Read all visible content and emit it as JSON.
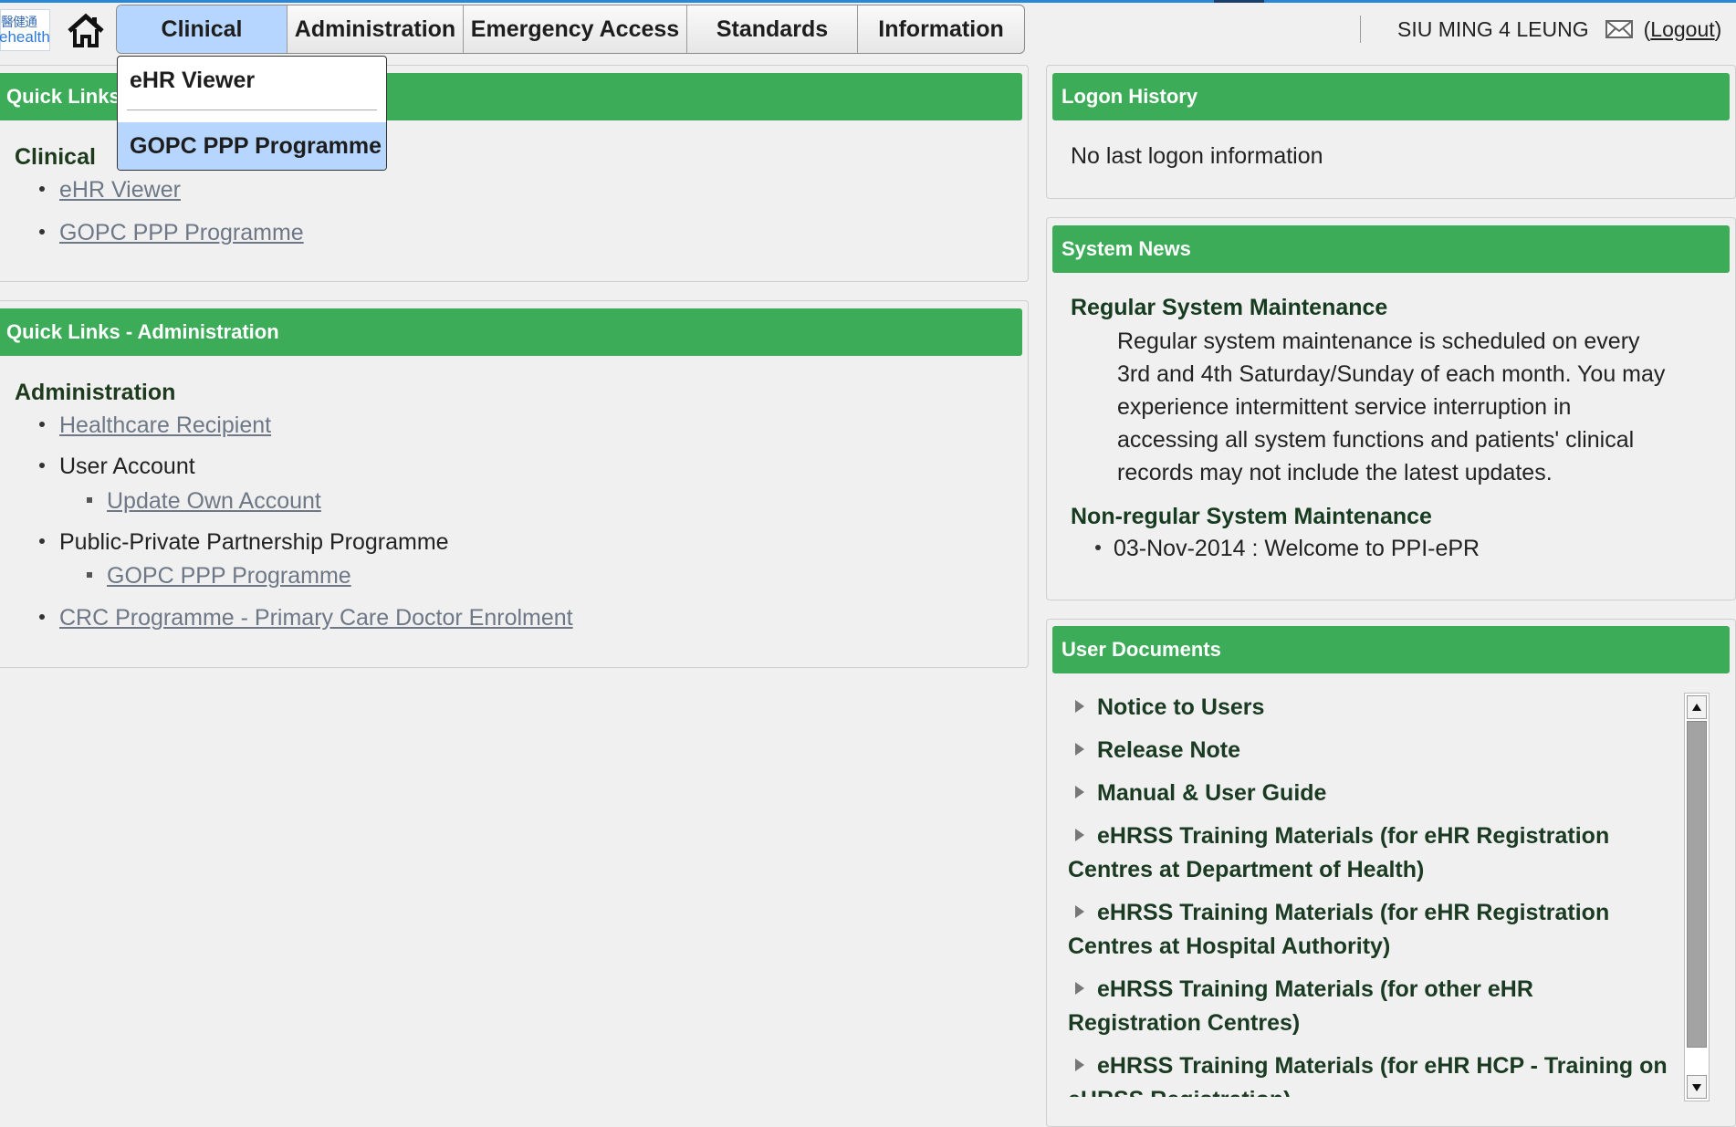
{
  "header": {
    "logo_cn": "醫健通",
    "logo_en": "ehealth",
    "menus": [
      "Clinical",
      "Administration",
      "Emergency Access",
      "Standards",
      "Information"
    ],
    "user_name": "SIU MING 4 LEUNG",
    "logout_label": "Logout"
  },
  "dropdown": {
    "items": [
      "eHR Viewer",
      "GOPC PPP Programme"
    ]
  },
  "quick_links_clinical": {
    "title": "Quick Links - Clinical",
    "section": "Clinical",
    "links": [
      "eHR Viewer",
      "GOPC PPP Programme"
    ]
  },
  "quick_links_admin": {
    "title": "Quick Links - Administration",
    "section": "Administration",
    "healthcare_recipient": "Healthcare Recipient",
    "user_account": "User Account",
    "update_own_account": "Update Own Account",
    "ppp": "Public-Private Partnership Programme",
    "gopc_ppp": "GOPC PPP Programme",
    "crc": "CRC Programme - Primary Care Doctor Enrolment"
  },
  "logon_history": {
    "title": "Logon History",
    "text": "No last logon information"
  },
  "system_news": {
    "title": "System News",
    "regular_title": "Regular System Maintenance",
    "regular_body": "Regular system maintenance is scheduled on every 3rd and 4th Saturday/Sunday of each month. You may experience intermittent service interruption in accessing all system functions and patients' clinical records may not include the latest updates.",
    "nonregular_title": "Non-regular System Maintenance",
    "nonregular_item": "03-Nov-2014 : Welcome to PPI-ePR"
  },
  "user_documents": {
    "title": "User Documents",
    "items": [
      "Notice to Users",
      "Release Note",
      "Manual & User Guide",
      "eHRSS Training Materials (for eHR Registration Centres at Department of Health)",
      "eHRSS Training Materials (for eHR Registration Centres at Hospital Authority)",
      "eHRSS Training Materials (for other eHR Registration Centres)",
      "eHRSS Training Materials (for eHR HCP - Training on eHRSS Registration)"
    ]
  }
}
